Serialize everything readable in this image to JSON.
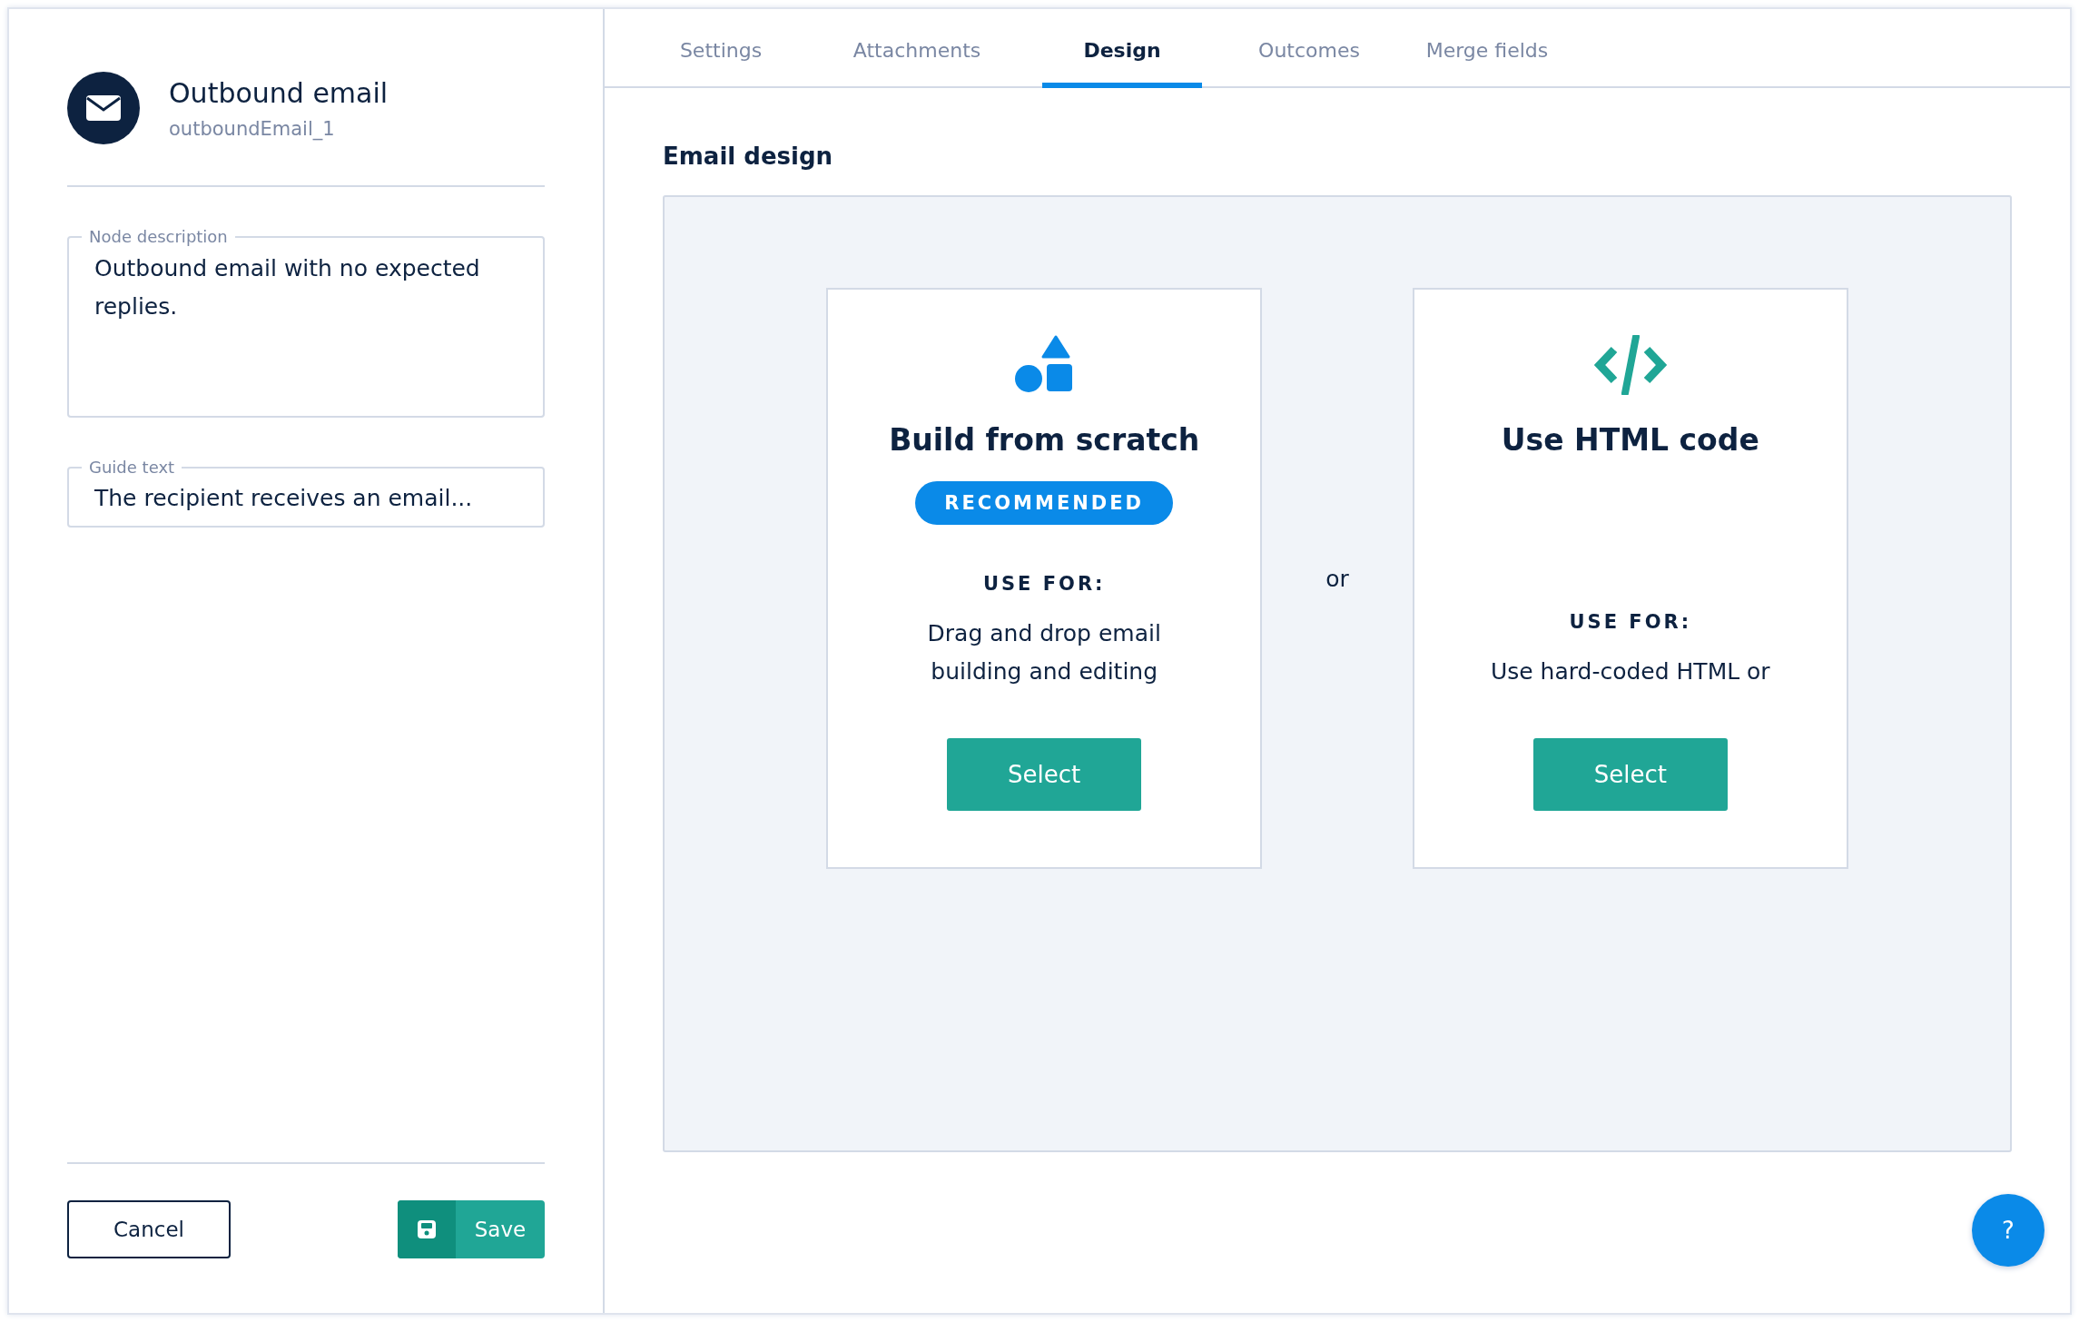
{
  "node": {
    "title": "Outbound email",
    "id": "outboundEmail_1"
  },
  "fields": [
    {
      "label": "Node description",
      "value": "Outbound email with no expected replies.",
      "kind": "textarea"
    },
    {
      "label": "Guide text",
      "value": "The recipient receives an email...",
      "kind": "input"
    }
  ],
  "actions": {
    "cancel": "Cancel",
    "save": "Save"
  },
  "tabs": [
    {
      "label": "Settings",
      "selected": false
    },
    {
      "label": "Attachments",
      "selected": false
    },
    {
      "label": "Design",
      "selected": true
    },
    {
      "label": "Outcomes",
      "selected": false
    },
    {
      "label": "Merge fields",
      "selected": false
    }
  ],
  "section_title": "Email design",
  "options": [
    {
      "kind": "shapes",
      "title": "Build from scratch",
      "badge": "RECOMMENDED",
      "use_for_label": "USE FOR:",
      "description": "Drag and drop email building and editing",
      "button": "Select"
    },
    {
      "kind": "code",
      "title": "Use HTML code",
      "use_for_label": "USE FOR:",
      "description": "Use hard-coded HTML or",
      "button": "Select"
    }
  ],
  "separator": "or",
  "help_button": "?"
}
